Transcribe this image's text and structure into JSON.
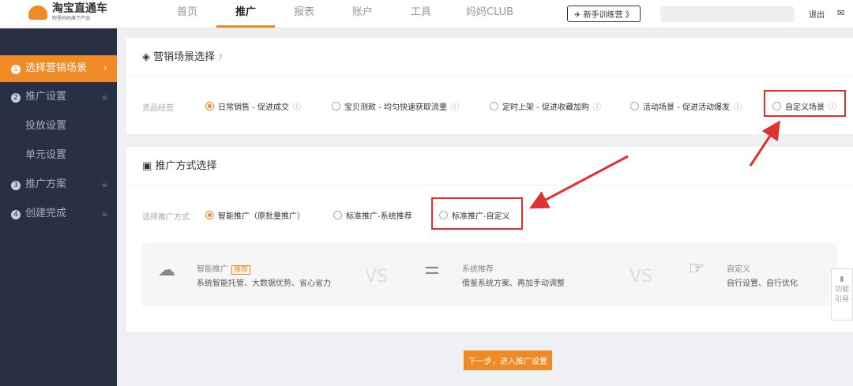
{
  "brand": {
    "name": "淘宝直通车",
    "slogan": "阿里妈妈旗下产品"
  },
  "nav": [
    "首页",
    "推广",
    "报表",
    "账户",
    "工具",
    "妈妈CLUB"
  ],
  "train": "新手训练营 》",
  "exit": "退出",
  "side": [
    {
      "n": "1",
      "l": "选择营销场景"
    },
    {
      "n": "2",
      "l": "推广设置"
    },
    {
      "l": "投放设置"
    },
    {
      "l": "单元设置"
    },
    {
      "n": "3",
      "l": "推广方案"
    },
    {
      "n": "4",
      "l": "创建完成"
    }
  ],
  "s1": {
    "title": "营销场景选择",
    "label": "货品经营",
    "opts": [
      "日常销售 - 促进成交",
      "宝贝测款 - 均匀快速获取流量",
      "定时上架 - 促进收藏加购",
      "活动场景 - 促进活动爆发",
      "自定义场景"
    ]
  },
  "s2": {
    "title": "推广方式选择",
    "label": "选择推广方式",
    "opts": [
      "智能推广（原批量推广）",
      "标准推广-系统推荐",
      "标准推广-自定义"
    ]
  },
  "cmp": {
    "a_t": "智能推广",
    "tag": "推荐",
    "a_d": "系统智能托管、大数据优势、省心省力",
    "vs": "VS",
    "b_t": "系统推荐",
    "b_d": "借鉴系统方案、再加手动调整",
    "c_t": "自定义",
    "c_d": "自行设置、自行优化"
  },
  "next": "下一步，进入推广设置",
  "guide": "功能引导"
}
